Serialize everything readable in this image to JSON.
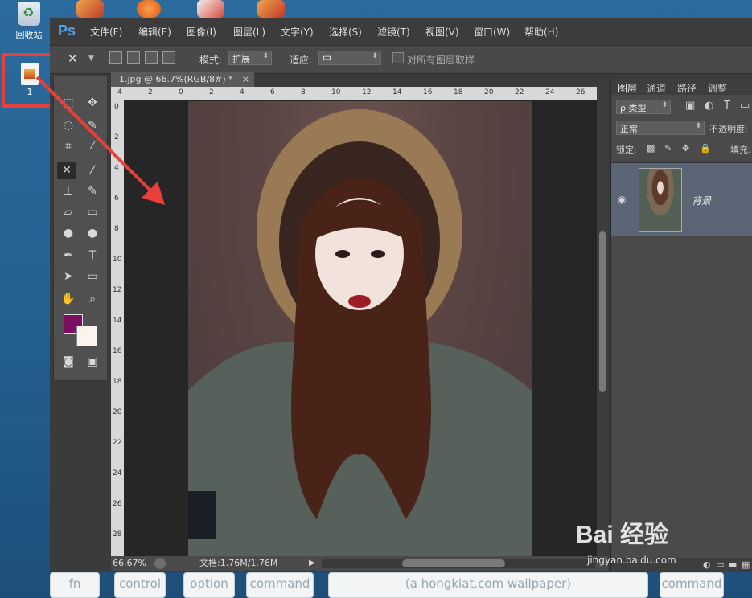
{
  "desktop": {
    "recycle_bin_label": "回收站",
    "file_label": "1"
  },
  "ps": {
    "logo": "Ps",
    "menu": [
      "文件(F)",
      "编辑(E)",
      "图像(I)",
      "图层(L)",
      "文字(Y)",
      "选择(S)",
      "滤镜(T)",
      "视图(V)",
      "窗口(W)",
      "帮助(H)"
    ],
    "options": {
      "mode_label": "模式:",
      "mode_value": "扩展",
      "adapt_label": "适应:",
      "adapt_value": "中",
      "sample_all_label": "对所有图层取样"
    },
    "document_tab": "1.jpg @ 66.7%(RGB/8#) *",
    "tab_close": "×",
    "ruler_h_ticks": [
      "4",
      "2",
      "0",
      "2",
      "4",
      "6",
      "8",
      "10",
      "12",
      "14",
      "16",
      "18",
      "20",
      "22",
      "24",
      "26"
    ],
    "ruler_v_ticks": [
      "0",
      "2",
      "4",
      "6",
      "8",
      "10",
      "12",
      "14",
      "16",
      "18",
      "20",
      "22",
      "24",
      "26",
      "28"
    ],
    "status_zoom": "66.67%",
    "status_doc": "文档:1.76M/1.76M",
    "colors": {
      "foreground": "#7c0f60",
      "background": "#faf3ee"
    }
  },
  "layers_panel": {
    "tabs": [
      "图层",
      "通道",
      "路径",
      "调整"
    ],
    "filter_label": "ρ 类型",
    "blend_mode": "正常",
    "opacity_label": "不透明度:",
    "lock_label": "锁定:",
    "fill_label": "填充:",
    "layer_name": "背景"
  },
  "keyboard": [
    "fn",
    "control",
    "option",
    "command",
    "(a hongkiat.com wallpaper)",
    "command"
  ],
  "watermark": {
    "brand": "Bai 经验",
    "url": "jingyan.baidu.com"
  }
}
